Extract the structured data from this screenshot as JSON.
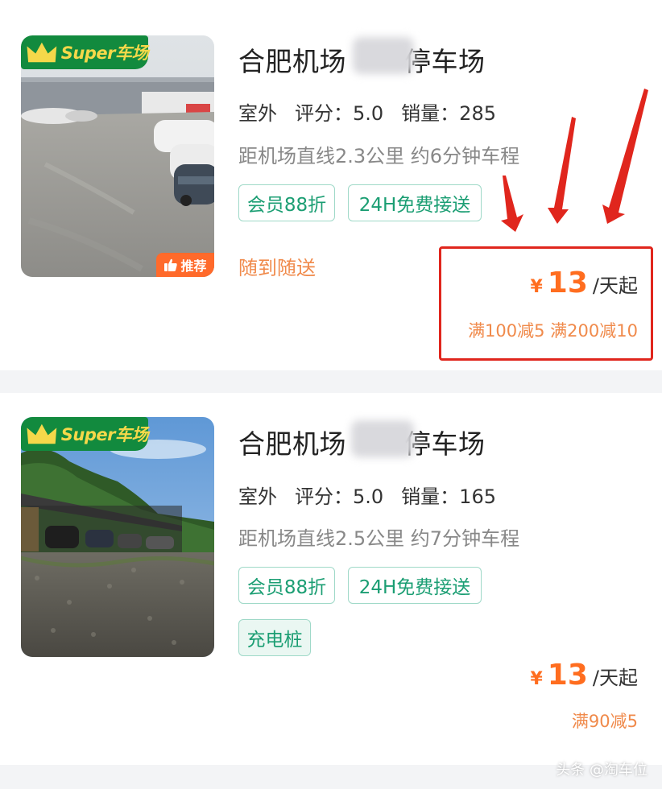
{
  "listings": [
    {
      "badge_super": "Super车场",
      "badge_recommend": "推荐",
      "title_prefix": "合肥机场",
      "title_suffix": "停车场",
      "type": "室外",
      "rating_label": "评分：",
      "rating": "5.0",
      "sales_label": "销量：",
      "sales": "285",
      "distance": "距机场直线2.3公里 约6分钟车程",
      "tags": [
        "会员88折",
        "24H免费接送"
      ],
      "delivery": "随到随送",
      "price_currency": "¥",
      "price_amount": "13",
      "price_unit": "/天起",
      "discount": "满100减5 满200减10"
    },
    {
      "badge_super": "Super车场",
      "title_prefix": "合肥机场",
      "title_suffix": "停车场",
      "type": "室外",
      "rating_label": "评分：",
      "rating": "5.0",
      "sales_label": "销量：",
      "sales": "165",
      "distance": "距机场直线2.5公里 约7分钟车程",
      "tags": [
        "会员88折",
        "24H免费接送",
        "充电桩"
      ],
      "price_currency": "¥",
      "price_amount": "13",
      "price_unit": "/天起",
      "discount": "满90减5"
    }
  ],
  "watermark": "头条 @淘车位",
  "colors": {
    "accent_orange": "#ff6d1f",
    "tag_green": "#1b9e73",
    "badge_green": "#128a3e",
    "annotation_red": "#e0261d"
  }
}
